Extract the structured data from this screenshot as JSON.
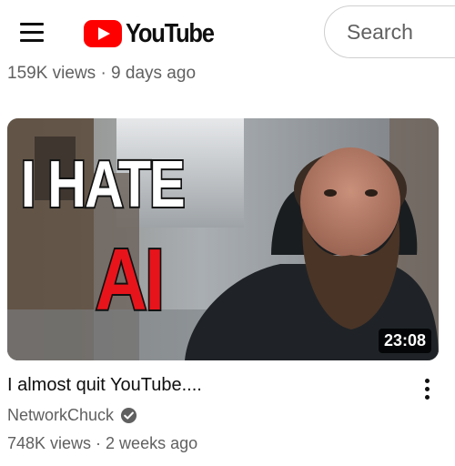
{
  "header": {
    "logo_text": "YouTube",
    "search_placeholder": "Search",
    "brand_color": "#ff0000"
  },
  "previous_video": {
    "meta": "159K views · 9 days ago"
  },
  "video": {
    "thumbnail_text_line1": "I HATE",
    "thumbnail_text_line2": "AI",
    "duration": "23:08",
    "title": "I almost quit YouTube....",
    "channel": "NetworkChuck",
    "channel_verified": true,
    "meta": "748K views · 2 weeks ago"
  },
  "icons": [
    "menu-icon",
    "youtube-logo-icon",
    "verified-icon",
    "more-options-icon"
  ]
}
